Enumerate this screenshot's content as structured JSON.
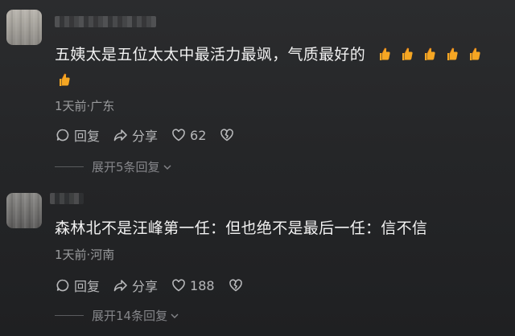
{
  "comments": [
    {
      "text": "五姨太是五位太太中最活力最飒，气质最好的",
      "emoji": "thumbs-up-icon",
      "emoji_count": 6,
      "time_location": "1天前·广东",
      "reply_label": "回复",
      "share_label": "分享",
      "like_count": "62",
      "expand_label": "展开5条回复"
    },
    {
      "text": "森林北不是汪峰第一任：但也绝不是最后一任：信不信",
      "time_location": "1天前·河南",
      "reply_label": "回复",
      "share_label": "分享",
      "like_count": "188",
      "expand_label": "展开14条回复"
    }
  ],
  "colors": {
    "background": "#252628",
    "text": "#f1f1f1",
    "meta": "#9a9b9d",
    "thumb": "#f5a623"
  }
}
